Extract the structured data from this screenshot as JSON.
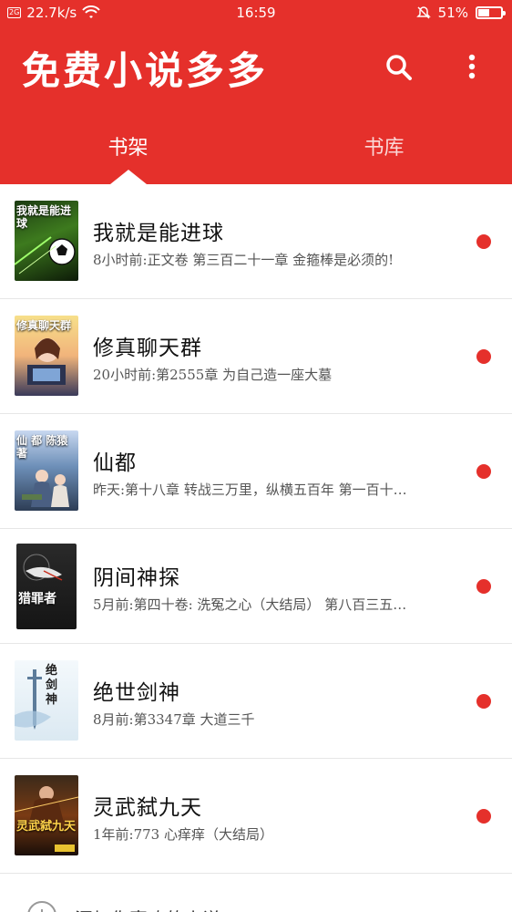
{
  "status_bar": {
    "sim": "2G",
    "speed": "22.7k/s",
    "time": "16:59",
    "battery": "51%",
    "battery_level": 0.51
  },
  "app_bar": {
    "title": "免费小说多多"
  },
  "tabs": [
    {
      "label": "书架",
      "selected": true
    },
    {
      "label": "书库",
      "selected": false
    }
  ],
  "books": [
    {
      "title": "我就是能进球",
      "subtitle": "8小时前:正文卷 第三百二十一章 金箍棒是必须的!",
      "cover_text": "我就是能进球"
    },
    {
      "title": "修真聊天群",
      "subtitle": "20小时前:第2555章 为自己造一座大墓",
      "cover_text": "修真聊天群"
    },
    {
      "title": "仙都",
      "subtitle": "昨天:第十八章 转战三万里，纵横五百年 第一百十…",
      "cover_text": "仙 都 陈猿 著"
    },
    {
      "title": "阴间神探",
      "subtitle": "5月前:第四十卷: 洗冤之心（大结局） 第八百三五…",
      "cover_text": "猎罪者"
    },
    {
      "title": "绝世剑神",
      "subtitle": "8月前:第3347章  大道三千",
      "cover_text": "绝剑神"
    },
    {
      "title": "灵武弑九天",
      "subtitle": "1年前:773 心痒痒（大结局）",
      "cover_text": "灵武弑九天"
    }
  ],
  "add_row": {
    "label": "添加你喜欢的小说"
  },
  "colors": {
    "primary": "#e5302b",
    "divider": "#e6e6e6",
    "text_primary": "#111111",
    "text_secondary": "#555555"
  },
  "icons": {
    "search": "search-icon",
    "more": "more-vertical-icon",
    "wifi": "wifi-icon",
    "alarm": "alarm-off-icon",
    "battery": "battery-icon",
    "add": "add-circle-icon"
  }
}
